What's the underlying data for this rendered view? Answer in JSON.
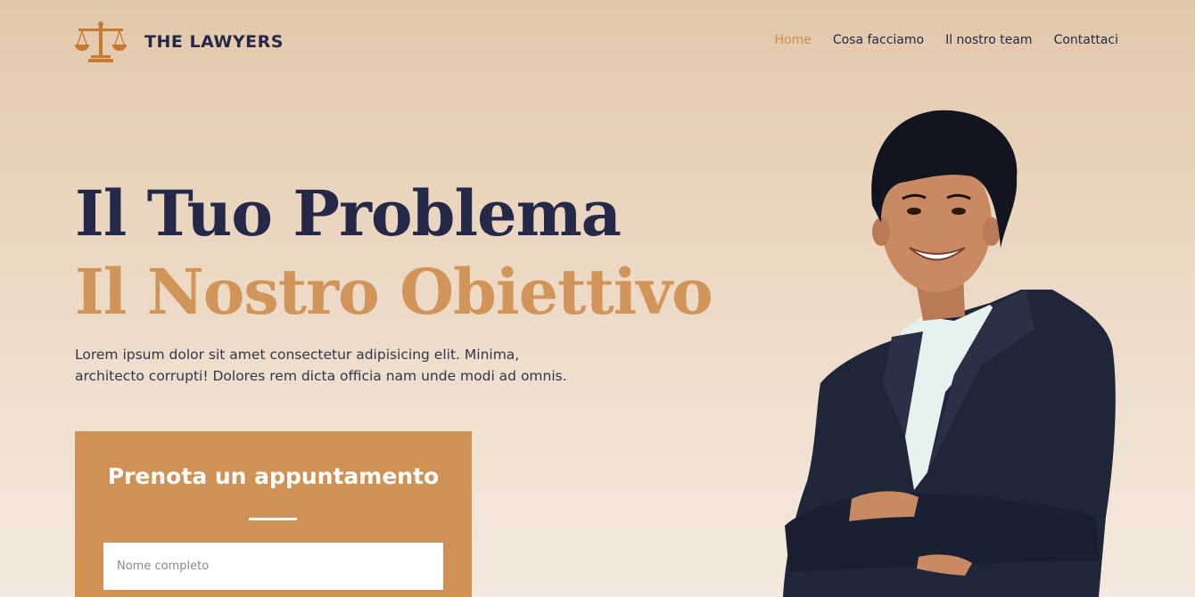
{
  "header": {
    "brand": "THE LAWYERS",
    "logo_icon": "scales-of-justice-icon",
    "nav": [
      {
        "label": "Home",
        "active": true
      },
      {
        "label": "Cosa facciamo",
        "active": false
      },
      {
        "label": "Il nostro team",
        "active": false
      },
      {
        "label": "Contattaci",
        "active": false
      }
    ]
  },
  "hero": {
    "title_line1": "Il Tuo Problema",
    "title_line2": "Il Nostro Obiettivo",
    "description": "Lorem ipsum dolor sit amet consectetur adipisicing elit. Minima, architecto corrupti! Dolores rem dicta officia nam unde modi ad omnis."
  },
  "booking": {
    "title": "Prenota un appuntamento",
    "name_placeholder": "Nome completo"
  },
  "colors": {
    "accent": "#d09254",
    "nav_active": "#c98f52",
    "dark_navy": "#262848"
  }
}
